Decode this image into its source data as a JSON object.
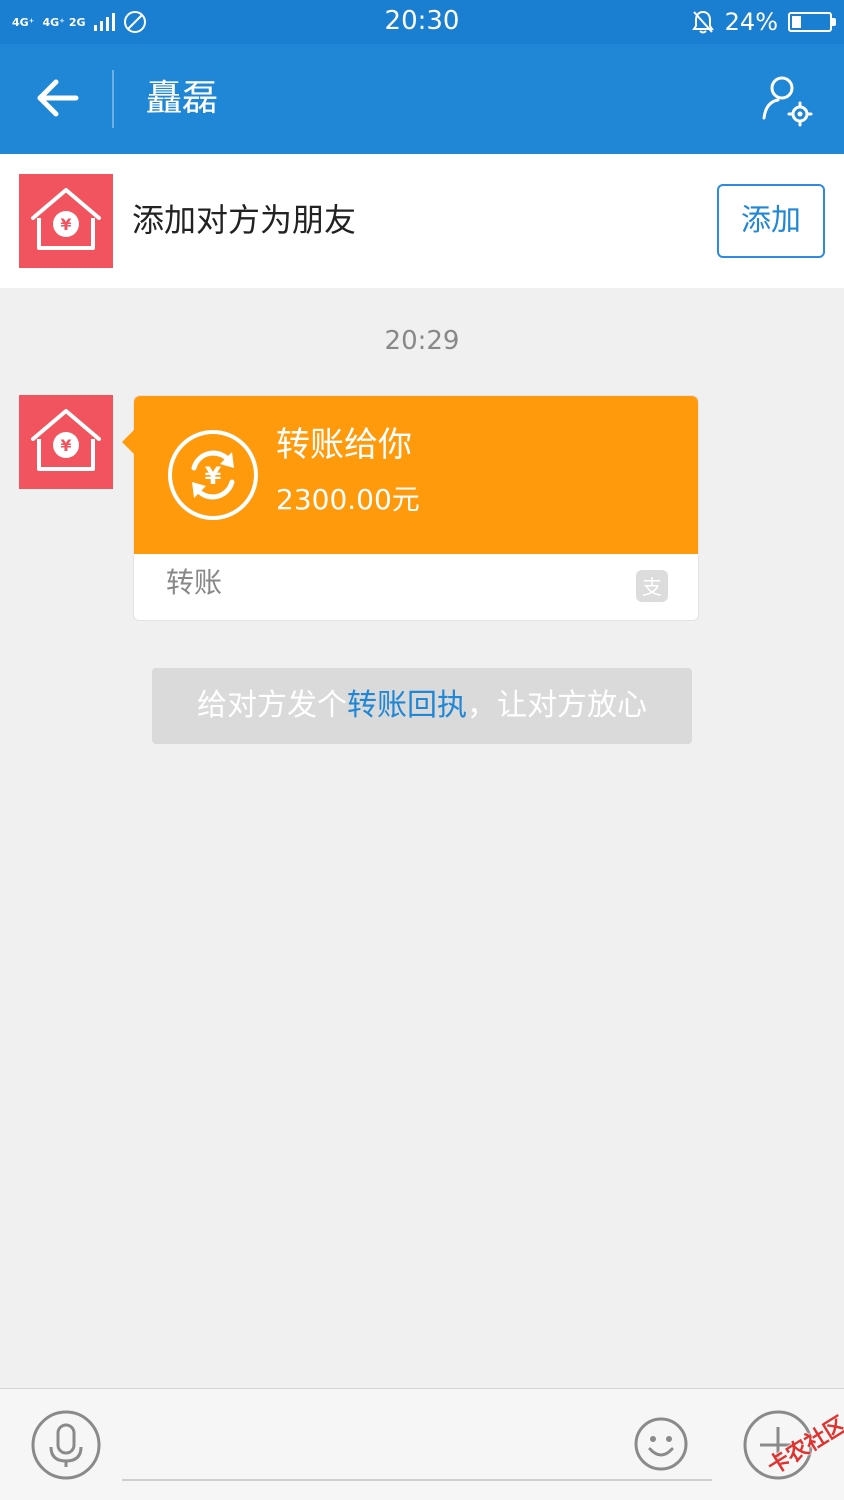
{
  "status_bar": {
    "network_1": "4G⁺",
    "network_2": "4G⁺ 2G",
    "time": "20:30",
    "battery_percent": "24%",
    "battery_level": 0.24
  },
  "header": {
    "title": "矗磊",
    "back_icon": "arrow-left-icon",
    "settings_icon": "user-settings-icon"
  },
  "friend_banner": {
    "text": "添加对方为朋友",
    "add_label": "添加"
  },
  "chat": {
    "timestamp": "20:29",
    "transfer": {
      "title": "转账给你",
      "amount": "2300.00元",
      "footer_label": "转账",
      "brand_icon": "alipay-icon"
    },
    "tip": {
      "prefix": "给对方发个",
      "link": "转账回执",
      "suffix": "，让对方放心"
    }
  },
  "input_bar": {
    "input_value": "",
    "watermark": "卡农社区"
  },
  "colors": {
    "status_bar": "#1a7fd0",
    "header": "#1f87d6",
    "transfer_card": "#ff9a0d",
    "avatar": "#f1545f",
    "link": "#1f87d6"
  }
}
